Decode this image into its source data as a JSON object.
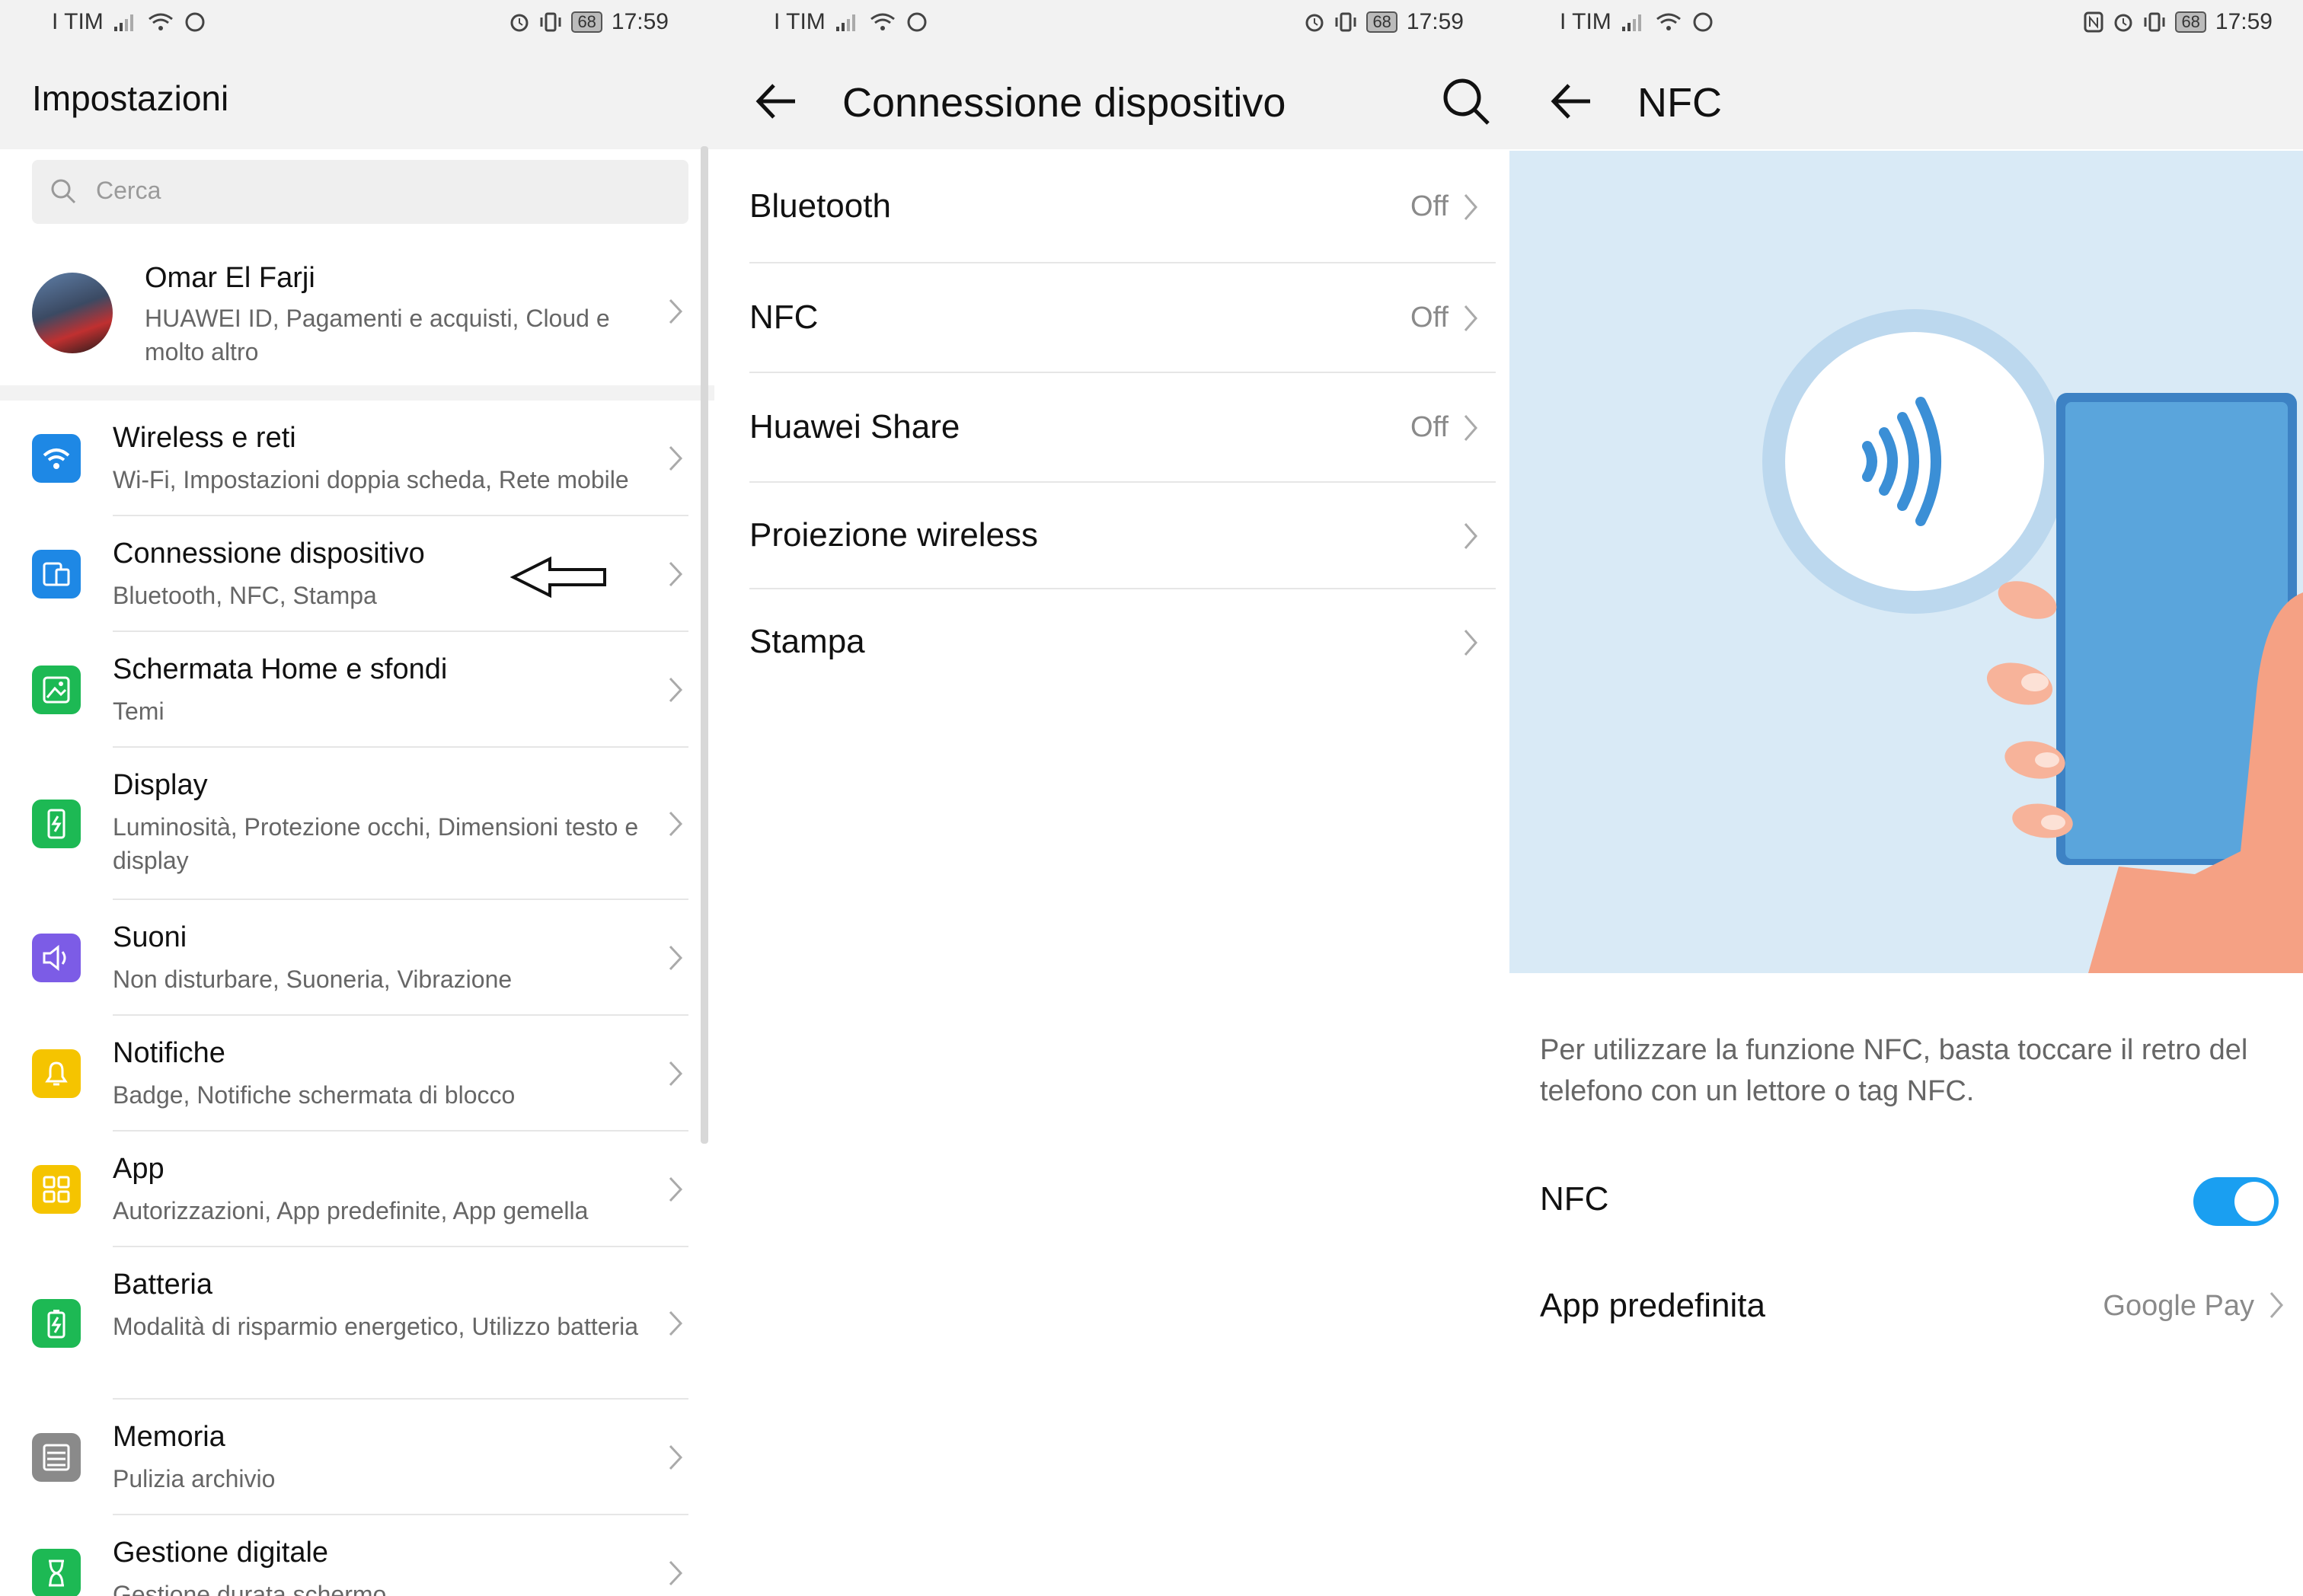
{
  "status": {
    "carrier": "I TIM",
    "time": "17:59",
    "battery": "68"
  },
  "screen1": {
    "title": "Impostazioni",
    "search_placeholder": "Cerca",
    "profile": {
      "name": "Omar El Farji",
      "subtitle": "HUAWEI ID, Pagamenti e acquisti, Cloud e molto altro"
    },
    "items": [
      {
        "title": "Wireless e reti",
        "subtitle": "Wi-Fi, Impostazioni doppia scheda, Rete mobile",
        "color": "#1e88e5",
        "icon": "wifi-icon"
      },
      {
        "title": "Connessione dispositivo",
        "subtitle": "Bluetooth, NFC, Stampa",
        "color": "#1e88e5",
        "icon": "device-connection-icon"
      },
      {
        "title": "Schermata Home e sfondi",
        "subtitle": "Temi",
        "color": "#1db954",
        "icon": "wallpaper-icon"
      },
      {
        "title": "Display",
        "subtitle": "Luminosità, Protezione occhi, Dimensioni testo e display",
        "color": "#1db954",
        "icon": "display-icon"
      },
      {
        "title": "Suoni",
        "subtitle": "Non disturbare, Suoneria, Vibrazione",
        "color": "#7c5ce6",
        "icon": "sound-icon"
      },
      {
        "title": "Notifiche",
        "subtitle": "Badge, Notifiche schermata di blocco",
        "color": "#f5c400",
        "icon": "bell-icon"
      },
      {
        "title": "App",
        "subtitle": "Autorizzazioni, App predefinite, App gemella",
        "color": "#f5c400",
        "icon": "apps-grid-icon"
      },
      {
        "title": "Batteria",
        "subtitle": "Modalità di risparmio energetico, Utilizzo batteria",
        "color": "#1db954",
        "icon": "battery-icon"
      },
      {
        "title": "Memoria",
        "subtitle": "Pulizia archivio",
        "color": "#8a8a8a",
        "icon": "storage-icon"
      },
      {
        "title": "Gestione digitale",
        "subtitle": "Gestione durata schermo",
        "color": "#1db954",
        "icon": "hourglass-icon"
      }
    ]
  },
  "screen2": {
    "title": "Connessione dispositivo",
    "rows": [
      {
        "title": "Bluetooth",
        "value": "Off"
      },
      {
        "title": "NFC",
        "value": "Off"
      },
      {
        "title": "Huawei Share",
        "value": "Off"
      },
      {
        "title": "Proiezione wireless",
        "value": ""
      },
      {
        "title": "Stampa",
        "value": ""
      }
    ]
  },
  "screen3": {
    "title": "NFC",
    "description": "Per utilizzare la funzione NFC, basta toccare il retro del telefono con un lettore o tag NFC.",
    "nfc_label": "NFC",
    "nfc_enabled": true,
    "default_app_label": "App predefinita",
    "default_app_value": "Google Pay"
  },
  "colors": {
    "toggle_on": "#1a9ff1",
    "illustration_bg": "#d9eaf6",
    "phone_blue": "#5aa5dc"
  }
}
